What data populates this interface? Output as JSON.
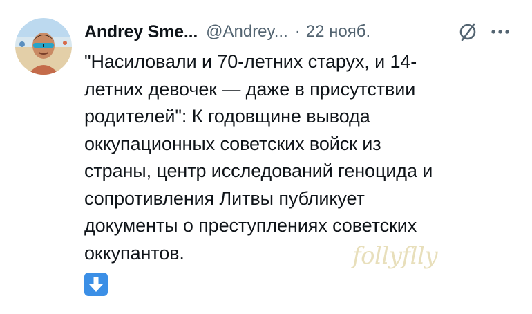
{
  "author": {
    "display_name": "Andrey Sme...",
    "handle": "@Andrey...",
    "separator": "·",
    "date": "22 нояб."
  },
  "icons": {
    "grok": "grok-slash-icon",
    "more": "more-horizontal-icon",
    "emoji": "down-arrow-emoji-icon",
    "emoji_color": "#3b8fe6"
  },
  "tweet": {
    "lines": [
      "\"Насиловали и 70-летних старух, и 14-",
      "летних девочек — даже в присутствии",
      "родителей\": К годовщине вывода",
      "оккупационных советских войск из",
      "страны, центр исследований геноцида и",
      "сопротивления Литвы публикует",
      "документы о преступлениях советских",
      "оккупантов."
    ]
  },
  "watermark": "follyflly"
}
